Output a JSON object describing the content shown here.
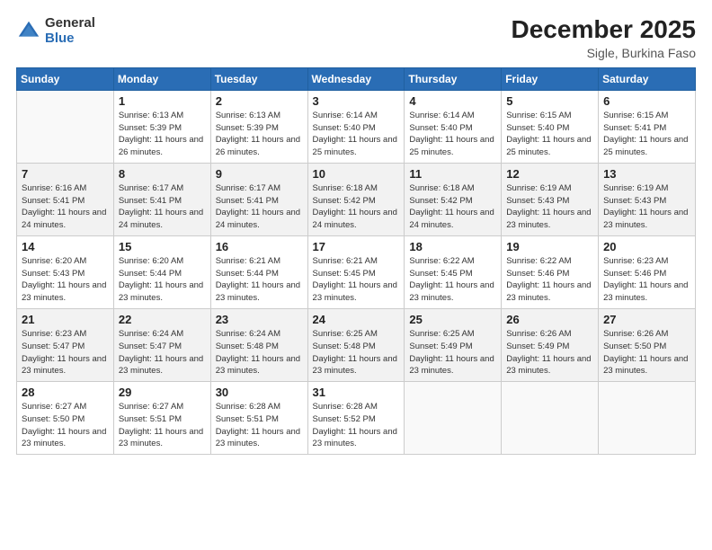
{
  "header": {
    "logo": {
      "general": "General",
      "blue": "Blue"
    },
    "title": "December 2025",
    "subtitle": "Sigle, Burkina Faso"
  },
  "calendar": {
    "weekdays": [
      "Sunday",
      "Monday",
      "Tuesday",
      "Wednesday",
      "Thursday",
      "Friday",
      "Saturday"
    ],
    "weeks": [
      [
        {
          "day": "",
          "sunrise": "",
          "sunset": "",
          "daylight": ""
        },
        {
          "day": "1",
          "sunrise": "Sunrise: 6:13 AM",
          "sunset": "Sunset: 5:39 PM",
          "daylight": "Daylight: 11 hours and 26 minutes."
        },
        {
          "day": "2",
          "sunrise": "Sunrise: 6:13 AM",
          "sunset": "Sunset: 5:39 PM",
          "daylight": "Daylight: 11 hours and 26 minutes."
        },
        {
          "day": "3",
          "sunrise": "Sunrise: 6:14 AM",
          "sunset": "Sunset: 5:40 PM",
          "daylight": "Daylight: 11 hours and 25 minutes."
        },
        {
          "day": "4",
          "sunrise": "Sunrise: 6:14 AM",
          "sunset": "Sunset: 5:40 PM",
          "daylight": "Daylight: 11 hours and 25 minutes."
        },
        {
          "day": "5",
          "sunrise": "Sunrise: 6:15 AM",
          "sunset": "Sunset: 5:40 PM",
          "daylight": "Daylight: 11 hours and 25 minutes."
        },
        {
          "day": "6",
          "sunrise": "Sunrise: 6:15 AM",
          "sunset": "Sunset: 5:41 PM",
          "daylight": "Daylight: 11 hours and 25 minutes."
        }
      ],
      [
        {
          "day": "7",
          "sunrise": "Sunrise: 6:16 AM",
          "sunset": "Sunset: 5:41 PM",
          "daylight": "Daylight: 11 hours and 24 minutes."
        },
        {
          "day": "8",
          "sunrise": "Sunrise: 6:17 AM",
          "sunset": "Sunset: 5:41 PM",
          "daylight": "Daylight: 11 hours and 24 minutes."
        },
        {
          "day": "9",
          "sunrise": "Sunrise: 6:17 AM",
          "sunset": "Sunset: 5:41 PM",
          "daylight": "Daylight: 11 hours and 24 minutes."
        },
        {
          "day": "10",
          "sunrise": "Sunrise: 6:18 AM",
          "sunset": "Sunset: 5:42 PM",
          "daylight": "Daylight: 11 hours and 24 minutes."
        },
        {
          "day": "11",
          "sunrise": "Sunrise: 6:18 AM",
          "sunset": "Sunset: 5:42 PM",
          "daylight": "Daylight: 11 hours and 24 minutes."
        },
        {
          "day": "12",
          "sunrise": "Sunrise: 6:19 AM",
          "sunset": "Sunset: 5:43 PM",
          "daylight": "Daylight: 11 hours and 23 minutes."
        },
        {
          "day": "13",
          "sunrise": "Sunrise: 6:19 AM",
          "sunset": "Sunset: 5:43 PM",
          "daylight": "Daylight: 11 hours and 23 minutes."
        }
      ],
      [
        {
          "day": "14",
          "sunrise": "Sunrise: 6:20 AM",
          "sunset": "Sunset: 5:43 PM",
          "daylight": "Daylight: 11 hours and 23 minutes."
        },
        {
          "day": "15",
          "sunrise": "Sunrise: 6:20 AM",
          "sunset": "Sunset: 5:44 PM",
          "daylight": "Daylight: 11 hours and 23 minutes."
        },
        {
          "day": "16",
          "sunrise": "Sunrise: 6:21 AM",
          "sunset": "Sunset: 5:44 PM",
          "daylight": "Daylight: 11 hours and 23 minutes."
        },
        {
          "day": "17",
          "sunrise": "Sunrise: 6:21 AM",
          "sunset": "Sunset: 5:45 PM",
          "daylight": "Daylight: 11 hours and 23 minutes."
        },
        {
          "day": "18",
          "sunrise": "Sunrise: 6:22 AM",
          "sunset": "Sunset: 5:45 PM",
          "daylight": "Daylight: 11 hours and 23 minutes."
        },
        {
          "day": "19",
          "sunrise": "Sunrise: 6:22 AM",
          "sunset": "Sunset: 5:46 PM",
          "daylight": "Daylight: 11 hours and 23 minutes."
        },
        {
          "day": "20",
          "sunrise": "Sunrise: 6:23 AM",
          "sunset": "Sunset: 5:46 PM",
          "daylight": "Daylight: 11 hours and 23 minutes."
        }
      ],
      [
        {
          "day": "21",
          "sunrise": "Sunrise: 6:23 AM",
          "sunset": "Sunset: 5:47 PM",
          "daylight": "Daylight: 11 hours and 23 minutes."
        },
        {
          "day": "22",
          "sunrise": "Sunrise: 6:24 AM",
          "sunset": "Sunset: 5:47 PM",
          "daylight": "Daylight: 11 hours and 23 minutes."
        },
        {
          "day": "23",
          "sunrise": "Sunrise: 6:24 AM",
          "sunset": "Sunset: 5:48 PM",
          "daylight": "Daylight: 11 hours and 23 minutes."
        },
        {
          "day": "24",
          "sunrise": "Sunrise: 6:25 AM",
          "sunset": "Sunset: 5:48 PM",
          "daylight": "Daylight: 11 hours and 23 minutes."
        },
        {
          "day": "25",
          "sunrise": "Sunrise: 6:25 AM",
          "sunset": "Sunset: 5:49 PM",
          "daylight": "Daylight: 11 hours and 23 minutes."
        },
        {
          "day": "26",
          "sunrise": "Sunrise: 6:26 AM",
          "sunset": "Sunset: 5:49 PM",
          "daylight": "Daylight: 11 hours and 23 minutes."
        },
        {
          "day": "27",
          "sunrise": "Sunrise: 6:26 AM",
          "sunset": "Sunset: 5:50 PM",
          "daylight": "Daylight: 11 hours and 23 minutes."
        }
      ],
      [
        {
          "day": "28",
          "sunrise": "Sunrise: 6:27 AM",
          "sunset": "Sunset: 5:50 PM",
          "daylight": "Daylight: 11 hours and 23 minutes."
        },
        {
          "day": "29",
          "sunrise": "Sunrise: 6:27 AM",
          "sunset": "Sunset: 5:51 PM",
          "daylight": "Daylight: 11 hours and 23 minutes."
        },
        {
          "day": "30",
          "sunrise": "Sunrise: 6:28 AM",
          "sunset": "Sunset: 5:51 PM",
          "daylight": "Daylight: 11 hours and 23 minutes."
        },
        {
          "day": "31",
          "sunrise": "Sunrise: 6:28 AM",
          "sunset": "Sunset: 5:52 PM",
          "daylight": "Daylight: 11 hours and 23 minutes."
        },
        {
          "day": "",
          "sunrise": "",
          "sunset": "",
          "daylight": ""
        },
        {
          "day": "",
          "sunrise": "",
          "sunset": "",
          "daylight": ""
        },
        {
          "day": "",
          "sunrise": "",
          "sunset": "",
          "daylight": ""
        }
      ]
    ]
  }
}
